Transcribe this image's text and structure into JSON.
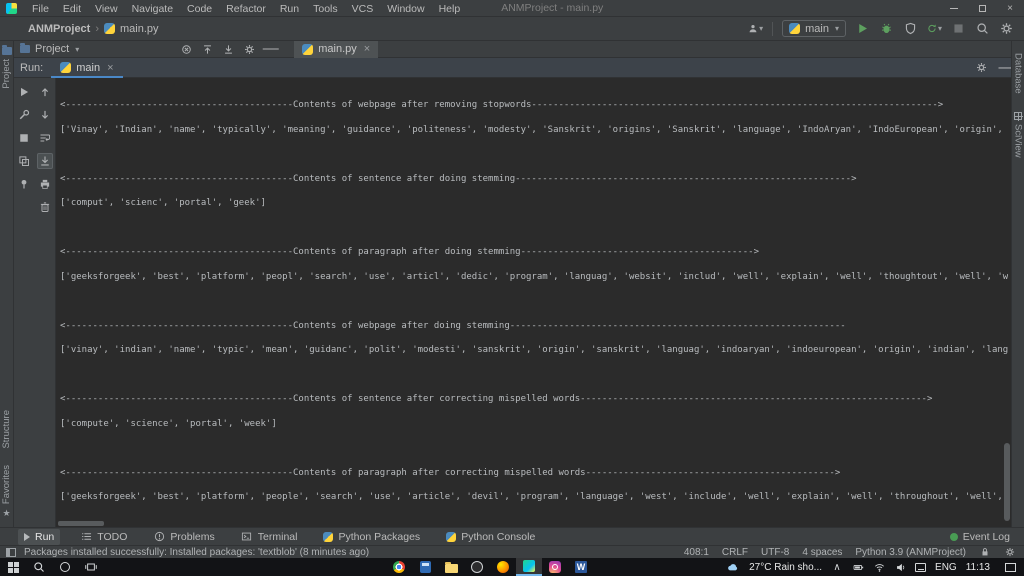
{
  "window": {
    "title": "ANMProject - main.py"
  },
  "menu_bar": {
    "items": [
      "File",
      "Edit",
      "View",
      "Navigate",
      "Code",
      "Refactor",
      "Run",
      "Tools",
      "VCS",
      "Window",
      "Help"
    ]
  },
  "main_toolbar": {
    "breadcrumb": {
      "project": "ANMProject",
      "file": "main.py"
    },
    "run_config": "main"
  },
  "project_panel": {
    "title": "Project"
  },
  "editor_tabs": {
    "active": "main.py"
  },
  "run_panel": {
    "label": "Run:",
    "tab_label": "main"
  },
  "stripes": {
    "left_top": "Project",
    "left_bottom": [
      "Structure",
      "Favorites"
    ],
    "right": [
      "Database",
      "SciView"
    ]
  },
  "console": {
    "lines": [
      "<------------------------------------------Contents of webpage after removing stopwords--------------------------------------------------------------------------->",
      "['Vinay', 'Indian', 'name', 'typically', 'meaning', 'guidance', 'politeness', 'modesty', 'Sanskrit', 'origins', 'Sanskrit', 'language', 'IndoAryan', 'IndoEuropean', 'origin', 'Indian', 'languages', 'Sanskrit']",
      "",
      "<------------------------------------------Contents of sentence after doing stemming-------------------------------------------------------------->",
      "['comput', 'scienc', 'portal', 'geek']",
      "",
      "<------------------------------------------Contents of paragraph after doing stemming------------------------------------------->",
      "['geeksforgeek', 'best', 'platform', 'peopl', 'search', 'use', 'articl', 'dedic', 'program', 'languag', 'websit', 'includ', 'well', 'explain', 'well', 'thoughtout', 'well', 'written']",
      "",
      "<------------------------------------------Contents of webpage after doing stemming--------------------------------------------------------------",
      "['vinay', 'indian', 'name', 'typic', 'mean', 'guidanc', 'polit', 'modesti', 'sanskrit', 'origin', 'sanskrit', 'languag', 'indoaryan', 'indoeuropean', 'origin', 'indian', 'languag']",
      "",
      "<------------------------------------------Contents of sentence after correcting mispelled words---------------------------------------------------------------->",
      "['compute', 'science', 'portal', 'week']",
      "",
      "<------------------------------------------Contents of paragraph after correcting mispelled words---------------------------------------------->",
      "['geeksforgeek', 'best', 'platform', 'people', 'search', 'use', 'article', 'devil', 'program', 'language', 'west', 'include', 'well', 'explain', 'well', 'throughout', 'well', 'write']"
    ]
  },
  "tool_buttons": {
    "items": [
      {
        "label": "Run"
      },
      {
        "label": "TODO"
      },
      {
        "label": "Problems"
      },
      {
        "label": "Terminal"
      },
      {
        "label": "Python Packages"
      },
      {
        "label": "Python Console"
      }
    ],
    "event_log": "Event Log"
  },
  "status_bar": {
    "message": "Packages installed successfully: Installed packages: 'textblob' (8 minutes ago)",
    "caret": "408:1",
    "line_sep": "CRLF",
    "encoding": "UTF-8",
    "indent": "4 spaces",
    "interpreter": "Python 3.9 (ANMProject)"
  },
  "taskbar": {
    "weather": "27°C Rain sho...",
    "lang": "ENG",
    "time": "11:13"
  },
  "icons": {
    "dropdown": "▾",
    "breadcrumb_sep": "›",
    "close": "×",
    "restart": "↻",
    "star": "★",
    "locate": "⊗",
    "minimize": "—",
    "chevron_up": "∧"
  },
  "colors": {
    "accent": "#4a88c7",
    "run_green": "#5da05f"
  }
}
